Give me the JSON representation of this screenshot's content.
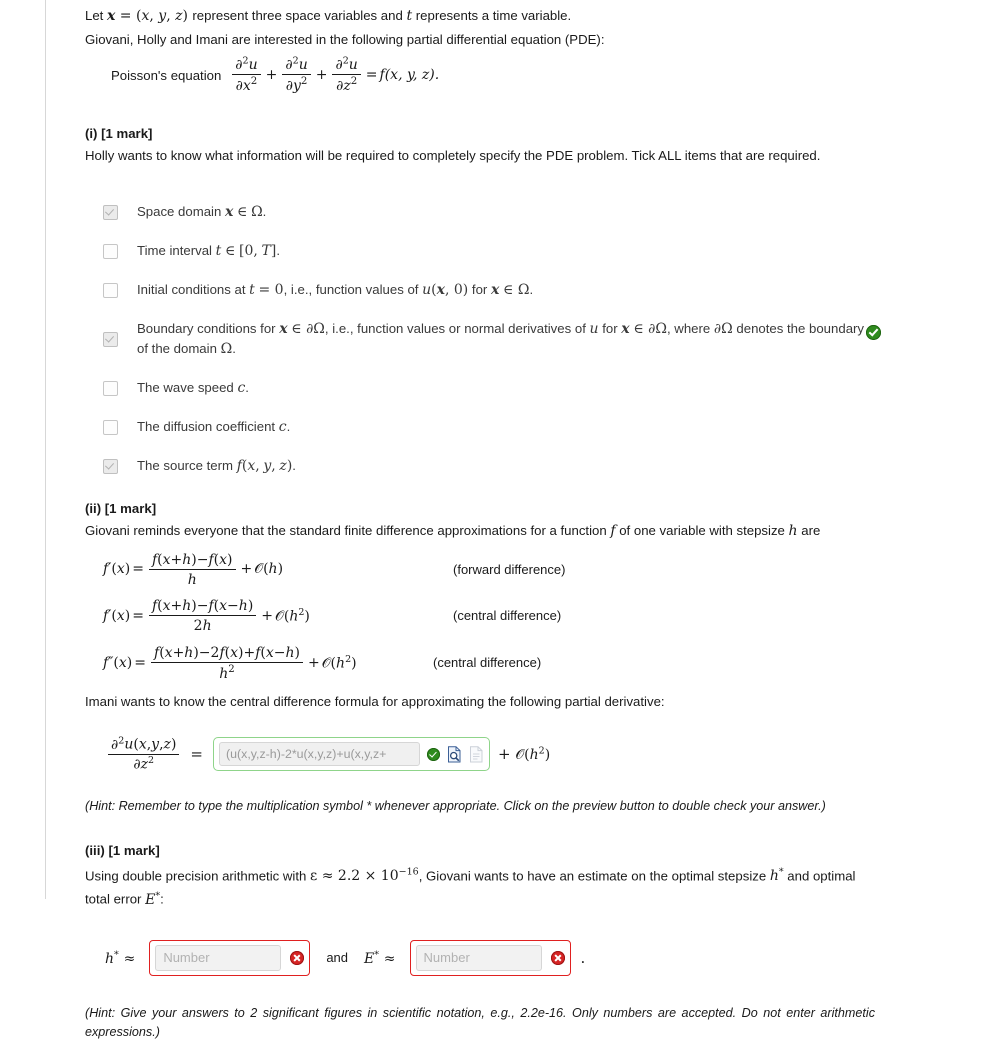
{
  "intro": {
    "line1_pre": "Let ",
    "line1_x": "x",
    "line1_eq": " = (x, y, z) ",
    "line1_mid": "represent three space variables and ",
    "line1_t": "t",
    "line1_post": " represents a time variable.",
    "line2": "Giovani, Holly and Imani are interested in the following partial differential equation (PDE):",
    "poisson_label": "Poisson's equation",
    "poisson_rhs": "f(x, y, z)."
  },
  "part_i": {
    "heading": "(i) [1 mark]",
    "question": "Holly wants to know what information will be required to completely specify the PDE problem. Tick ALL items that are required.",
    "items": [
      {
        "id": "space-domain",
        "checked": true,
        "text_plain": "Space domain x ∈ Ω."
      },
      {
        "id": "time-interval",
        "checked": false,
        "text_plain": "Time interval t ∈ [0, T]."
      },
      {
        "id": "initial-conditions",
        "checked": false,
        "text_plain": "Initial conditions at t = 0, i.e., function values of u(x, 0) for x ∈ Ω."
      },
      {
        "id": "boundary-conditions",
        "checked": true,
        "text_plain": "Boundary conditions for x ∈ ∂Ω, i.e., function values or normal derivatives of u for x ∈ ∂Ω, where ∂Ω denotes the boundary of the domain Ω."
      },
      {
        "id": "wave-speed",
        "checked": false,
        "text_plain": "The wave speed c."
      },
      {
        "id": "diffusion-coefficient",
        "checked": false,
        "text_plain": "The diffusion coefficient c."
      },
      {
        "id": "source-term",
        "checked": true,
        "text_plain": "The source term f(x, y, z)."
      }
    ],
    "correct_badge": "correct"
  },
  "part_ii": {
    "heading": "(ii) [1 mark]",
    "intro_a": "Giovani reminds everyone that the standard finite difference approximations for a function ",
    "intro_f": "f",
    "intro_b": " of one variable with stepsize ",
    "intro_h": "h",
    "intro_c": " are",
    "formulas": [
      {
        "lhs": "f′(x)",
        "num": "f(x+h)−f(x)",
        "den": "h",
        "order": "O(h)",
        "note": "(forward difference)"
      },
      {
        "lhs": "f′(x)",
        "num": "f(x+h)−f(x−h)",
        "den": "2h",
        "order": "O(h²)",
        "note": "(central difference)"
      },
      {
        "lhs": "f″(x)",
        "num": "f(x+h)−2f(x)+f(x−h)",
        "den": "h²",
        "order": "O(h²)",
        "note": "(central difference)"
      }
    ],
    "prompt": "Imani wants to know the central difference formula for approximating the following partial derivative:",
    "answer": {
      "lhs_num": "∂²u(x,y,z)",
      "lhs_den": "∂z²",
      "equals": "=",
      "value": "(u(x,y,z-h)-2*u(x,y,z)+u(x,y,z+",
      "placeholder": "Answer",
      "status": "valid",
      "preview_icon": "preview-page-icon",
      "secondary_icon": "page-icon",
      "tail": "+ O(h²)"
    },
    "hint": "(Hint: Remember to type the multiplication symbol * whenever appropriate. Click on the preview button to double check your answer.)"
  },
  "part_iii": {
    "heading": "(iii) [1 mark]",
    "question_a": "Using double precision arithmetic with ",
    "question_eps": "ε ≈ 2.2 × 10",
    "question_exp": "−16",
    "question_b": ", Giovani wants to have an estimate on the optimal stepsize ",
    "question_h": "h*",
    "question_c": " and optimal total error ",
    "question_E": "E*",
    "question_d": ":",
    "field_h_label": "h* ≈",
    "field_h_value": "",
    "field_h_placeholder": "Number",
    "field_h_status": "error",
    "and_word": "and",
    "field_E_label": "E* ≈",
    "field_E_value": "",
    "field_E_placeholder": "Number",
    "field_E_status": "error",
    "trailing_period": ".",
    "hint": "(Hint: Give your answers to 2 significant figures in scientific notation, e.g., 2.2e-16. Only numbers are accepted. Do not enter arithmetic expressions.)"
  },
  "colors": {
    "valid_green": "#2f8b1e",
    "field_green_border": "#8fd48a",
    "error_red": "#d62424",
    "error_border": "#e02020",
    "text": "#1a1a1a"
  }
}
